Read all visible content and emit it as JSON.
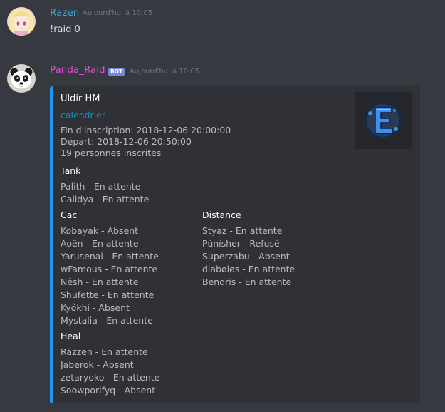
{
  "messages": [
    {
      "username": "Razen",
      "username_color": "#3ba8d9",
      "timestamp": "Aujourd'hui à 10:05",
      "content": "!raid 0"
    },
    {
      "username": "Panda_Raid",
      "username_color": "#e44cd9",
      "bot_tag": "BOT",
      "timestamp": "Aujourd'hui à 10:05"
    }
  ],
  "embed": {
    "accent_color": "#2196f3",
    "title": "Uldir HM",
    "link": "calendrier",
    "description": [
      "Fin d'inscription: 2018-12-06 20:00:00",
      "Départ: 2018-12-06 20:50:00",
      "19 personnes inscrites"
    ],
    "thumbnail_icon": "emblem-e-icon",
    "fields": {
      "tank": {
        "name": "Tank",
        "values": [
          "Palith - En attente",
          "Calidya - En attente"
        ]
      },
      "cac": {
        "name": "Cac",
        "values": [
          "Kobayak - Absent",
          "Aoên - En attente",
          "Yarusenai - En attente",
          "wFamous - En attente",
          "Nësh - En attente",
          "Shufette - En attente",
          "Kyôkhi - Absent",
          "Mystalia - En attente"
        ]
      },
      "distance": {
        "name": "Distance",
        "values": [
          "Styaz - En attente",
          "Pùnïsher - Refusé",
          "Superzabu - Absent",
          "diabøløs - En attente",
          "Bendris - En attente"
        ]
      },
      "heal": {
        "name": "Heal",
        "values": [
          "Räzzen - En attente",
          "Jaberok - Absent",
          "zetaryoko - En attente",
          "Soowporifyq - Absent"
        ]
      }
    }
  }
}
